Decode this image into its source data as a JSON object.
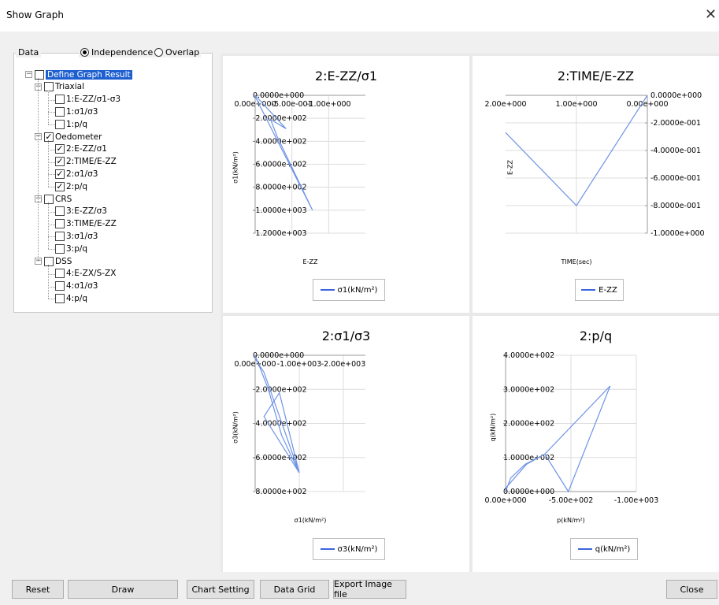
{
  "window": {
    "title": "Show Graph",
    "close_glyph": "✕"
  },
  "data_group": {
    "label": "Data",
    "radio_independence": "Independence",
    "radio_overlap": "Overlap",
    "selected_mode": "Independence"
  },
  "tree": {
    "root": "Define Graph Result",
    "groups": [
      {
        "label": "Triaxial",
        "checked": false,
        "items": [
          {
            "label": "1:E-ZZ/σ1-σ3",
            "checked": false
          },
          {
            "label": "1:σ1/σ3",
            "checked": false
          },
          {
            "label": "1:p/q",
            "checked": false
          }
        ]
      },
      {
        "label": "Oedometer",
        "checked": true,
        "items": [
          {
            "label": "2:E-ZZ/σ1",
            "checked": true
          },
          {
            "label": "2:TIME/E-ZZ",
            "checked": true
          },
          {
            "label": "2:σ1/σ3",
            "checked": true
          },
          {
            "label": "2:p/q",
            "checked": true
          }
        ]
      },
      {
        "label": "CRS",
        "checked": false,
        "items": [
          {
            "label": "3:E-ZZ/σ3",
            "checked": false
          },
          {
            "label": "3:TIME/E-ZZ",
            "checked": false
          },
          {
            "label": "3:σ1/σ3",
            "checked": false
          },
          {
            "label": "3:p/q",
            "checked": false
          }
        ]
      },
      {
        "label": "DSS",
        "checked": false,
        "items": [
          {
            "label": "4:E-ZX/S-ZX",
            "checked": false
          },
          {
            "label": "4:σ1/σ3",
            "checked": false
          },
          {
            "label": "4:p/q",
            "checked": false
          }
        ]
      }
    ]
  },
  "colors": {
    "series": "#6f93e6",
    "legend": "#3a66e0",
    "selection": "#1e5fd0"
  },
  "chart_data": [
    {
      "type": "line",
      "title": "2:E-ZZ/σ1",
      "xlabel": "E-ZZ",
      "ylabel": "σ1(kN/m²)",
      "xlim": [
        0,
        -1.5
      ],
      "ylim": [
        -1200,
        0
      ],
      "x_ticks": [
        0,
        -0.5,
        -1.0
      ],
      "x_tick_labels": [
        "0.00e+000",
        "-5.00e-001",
        "-1.00e+000"
      ],
      "y_ticks": [
        0,
        -200,
        -400,
        -600,
        -800,
        -1000,
        -1200
      ],
      "y_tick_labels": [
        "0.0000e+000",
        "-2.0000e+002",
        "-4.0000e+002",
        "-6.0000e+002",
        "-8.0000e+002",
        "-1.0000e+003",
        "-1.2000e+003"
      ],
      "grid": true,
      "legend": "bottom",
      "series": [
        {
          "name": "σ1(kN/m²)",
          "x": [
            0,
            -0.42,
            -0.21,
            -0.3,
            -0.78,
            0
          ],
          "y": [
            0,
            -290,
            -210,
            -360,
            -1000,
            -10
          ]
        }
      ]
    },
    {
      "type": "line",
      "title": "2:TIME/E-ZZ",
      "xlabel": "TIME(sec)",
      "ylabel": "E-ZZ",
      "xlim": [
        2.0,
        0
      ],
      "ylim": [
        -1.0,
        0
      ],
      "x_ticks": [
        2.0,
        1.0,
        0
      ],
      "x_tick_labels": [
        "2.00e+000",
        "1.00e+000",
        "0.00e+000"
      ],
      "y_ticks": [
        0,
        -0.2,
        -0.4,
        -0.6,
        -0.8,
        -1.0
      ],
      "y_tick_labels": [
        "0.0000e+000",
        "-2.0000e-001",
        "-4.0000e-001",
        "-6.0000e-001",
        "-8.0000e-001",
        "-1.0000e+000"
      ],
      "y_axis_side": "right",
      "grid": true,
      "legend": "bottom",
      "series": [
        {
          "name": "E-ZZ",
          "x": [
            2.0,
            1.0,
            0
          ],
          "y": [
            -0.27,
            -0.8,
            0
          ]
        }
      ]
    },
    {
      "type": "line",
      "title": "2:σ1/σ3",
      "xlabel": "σ1(kN/m²)",
      "ylabel": "σ3(kN/m²)",
      "xlim": [
        0,
        -2500
      ],
      "ylim": [
        -800,
        0
      ],
      "x_ticks": [
        0,
        -1000,
        -2000
      ],
      "x_tick_labels": [
        "0.00e+000",
        "-1.00e+003",
        "-2.00e+003"
      ],
      "y_ticks": [
        0,
        -200,
        -400,
        -600,
        -800
      ],
      "y_tick_labels": [
        "0.0000e+000",
        "-2.0000e+002",
        "-4.0000e+002",
        "-6.0000e+002",
        "-8.0000e+002"
      ],
      "grid": true,
      "legend": "bottom",
      "series": [
        {
          "name": "σ3(kN/m²)",
          "x": [
            0,
            -300,
            -600,
            -1000,
            -550,
            -200,
            -1000,
            -200,
            0
          ],
          "y": [
            0,
            -200,
            -470,
            -690,
            -220,
            -360,
            -690,
            -100,
            -20
          ]
        }
      ]
    },
    {
      "type": "line",
      "title": "2:p/q",
      "xlabel": "p(kN/m²)",
      "ylabel": "q(kN/m²)",
      "xlim": [
        0,
        -1000
      ],
      "ylim": [
        0,
        400
      ],
      "x_ticks": [
        0,
        -500,
        -1000
      ],
      "x_tick_labels": [
        "0.00e+000",
        "-5.00e+002",
        "-1.00e+003"
      ],
      "y_ticks": [
        0,
        100,
        200,
        300,
        400
      ],
      "y_tick_labels": [
        "0.0000e+000",
        "1.0000e+002",
        "2.0000e+002",
        "3.0000e+002",
        "4.0000e+002"
      ],
      "grid": true,
      "legend": "bottom",
      "series": [
        {
          "name": "q(kN/m²)",
          "x": [
            0,
            -40,
            -150,
            -300,
            -480,
            -800,
            -300,
            -160,
            0
          ],
          "y": [
            0,
            40,
            80,
            110,
            0,
            310,
            110,
            80,
            10
          ]
        }
      ]
    }
  ],
  "buttons": {
    "reset": "Reset",
    "draw": "Draw",
    "chart_setting": "Chart Setting",
    "data_grid": "Data Grid",
    "export": "Export Image file",
    "close": "Close"
  }
}
